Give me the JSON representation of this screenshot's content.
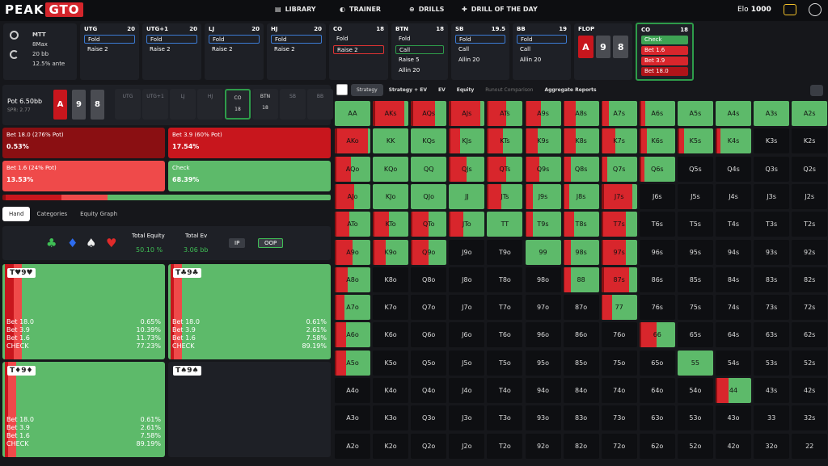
{
  "app": {
    "logo_a": "PEAK",
    "logo_b": "GTO",
    "nav": [
      "LIBRARY",
      "TRAINER",
      "DRILLS",
      "DRILL OF THE DAY"
    ],
    "elo_label": "Elo",
    "elo_value": "1000"
  },
  "game": {
    "format": "MTT",
    "table": "8Max",
    "stack": "20 bb",
    "ante": "12.5% ante"
  },
  "positions": [
    {
      "name": "UTG",
      "stack": "20",
      "actions": [
        "Fold",
        "Raise 2"
      ],
      "sel": 0,
      "style": "blue"
    },
    {
      "name": "UTG+1",
      "stack": "20",
      "actions": [
        "Fold",
        "Raise 2"
      ],
      "sel": 0,
      "style": "blue"
    },
    {
      "name": "LJ",
      "stack": "20",
      "actions": [
        "Fold",
        "Raise 2"
      ],
      "sel": 0,
      "style": "blue"
    },
    {
      "name": "HJ",
      "stack": "20",
      "actions": [
        "Fold",
        "Raise 2"
      ],
      "sel": 0,
      "style": "blue"
    },
    {
      "name": "CO",
      "stack": "18",
      "actions": [
        "Fold",
        "Raise 2"
      ],
      "sel": 1,
      "style": "red"
    },
    {
      "name": "BTN",
      "stack": "18",
      "actions": [
        "Fold",
        "Call",
        "Raise 5",
        "Allin 20"
      ],
      "sel": 1,
      "style": "green"
    },
    {
      "name": "SB",
      "stack": "19.5",
      "actions": [
        "Fold",
        "Call",
        "Allin 20"
      ],
      "sel": 0,
      "style": "blue"
    },
    {
      "name": "BB",
      "stack": "19",
      "actions": [
        "Fold",
        "Call",
        "Allin 20"
      ],
      "sel": 0,
      "style": "blue"
    }
  ],
  "flop": {
    "label": "FLOP",
    "cards": [
      "A",
      "9",
      "8"
    ]
  },
  "co_panel": {
    "name": "CO",
    "stack": "18",
    "actions": [
      "Check",
      "Bet 1.6",
      "Bet 3.9",
      "Bet 18.0"
    ]
  },
  "pot": {
    "label": "Pot",
    "value": "6.50bb",
    "spr": "SPR: 2.77",
    "cards": [
      "A",
      "9",
      "8"
    ]
  },
  "seats": [
    {
      "n": "UTG",
      "s": ""
    },
    {
      "n": "UTG+1",
      "s": ""
    },
    {
      "n": "LJ",
      "s": ""
    },
    {
      "n": "HJ",
      "s": ""
    },
    {
      "n": "CO",
      "s": "18"
    },
    {
      "n": "BTN",
      "s": "18"
    },
    {
      "n": "SB",
      "s": ""
    },
    {
      "n": "BB",
      "s": ""
    }
  ],
  "bets": [
    {
      "label": "Bet 18.0 (276% Pot)",
      "pct": "0.53%"
    },
    {
      "label": "Bet 3.9 (60% Pot)",
      "pct": "17.54%"
    },
    {
      "label": "Bet 1.6 (24% Pot)",
      "pct": "13.53%"
    },
    {
      "label": "Check",
      "pct": "68.39%"
    }
  ],
  "tabs": [
    "Hand",
    "Categories",
    "Equity Graph"
  ],
  "equity": {
    "te_label": "Total Equity",
    "te_value": "50.10 %",
    "ev_label": "Total Ev",
    "ev_value": "3.06 bb",
    "ip": "IP",
    "oop": "OOP"
  },
  "combos": [
    {
      "label": "T♥9♥",
      "lines": [
        [
          "Bet 18.0",
          "0.65%"
        ],
        [
          "Bet 3.9",
          "10.39%"
        ],
        [
          "Bet 1.6",
          "11.73%"
        ],
        [
          "CHECK",
          "77.23%"
        ]
      ]
    },
    {
      "label": "T♣9♣",
      "lines": [
        [
          "Bet 18.0",
          "0.61%"
        ],
        [
          "Bet 3.9",
          "2.61%"
        ],
        [
          "Bet 1.6",
          "7.58%"
        ],
        [
          "CHECK",
          "89.19%"
        ]
      ]
    },
    {
      "label": "T♦9♦",
      "lines": [
        [
          "Bet 18.0",
          "0.61%"
        ],
        [
          "Bet 3.9",
          "2.61%"
        ],
        [
          "Bet 1.6",
          "7.58%"
        ],
        [
          "CHECK",
          "89.19%"
        ]
      ]
    },
    {
      "label": "T♠9♠",
      "lines": []
    }
  ],
  "right_tabs": [
    "Strategy",
    "Strategy + EV",
    "EV",
    "Equity",
    "Runout Comparison",
    "Aggregate Reports"
  ],
  "colors": {
    "green": "#5dba6a",
    "red": "#d8262c",
    "darkred": "#8a0f12",
    "bg": "#16171b"
  }
}
